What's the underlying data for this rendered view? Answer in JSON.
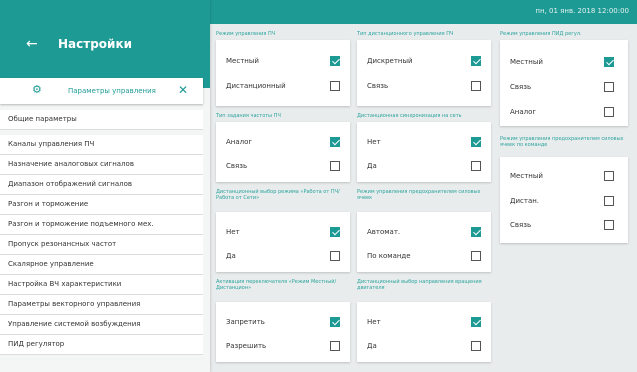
{
  "datetime": "пн, 01 янв. 2018 12:00:00",
  "sidebar": {
    "title": "Настройки",
    "back_icon": "arrow-left-icon",
    "group": {
      "label": "Параметры управления",
      "icon": "gear-icon",
      "close_icon": "close-icon"
    },
    "items": [
      "Общие параметры",
      "Каналы управления ПЧ",
      "Назначение аналоговых сигналов",
      "Диапазон отображений сигналов",
      "Разгон и торможение",
      "Разгон и торможение подъемного мех.",
      "Пропуск резонансных частот",
      "Скалярное управление",
      "Настройка ВЧ характеристики",
      "Параметры векторного управления",
      "Управление системой возбуждения",
      "ПИД регулятор"
    ]
  },
  "colors": {
    "accent": "#1e9a95",
    "background": "#e9ecec"
  },
  "panels": {
    "control_mode": {
      "caption": "Режим управления ПЧ",
      "options": [
        {
          "label": "Местный",
          "checked": true
        },
        {
          "label": "Дистанционный",
          "checked": false
        }
      ]
    },
    "remote_type": {
      "caption": "Тип дистанционного управления ПЧ",
      "options": [
        {
          "label": "Дискретный",
          "checked": true
        },
        {
          "label": "Связь",
          "checked": false
        }
      ]
    },
    "pid_mode": {
      "caption": "Режим управления ПИД регул.",
      "options": [
        {
          "label": "Местный",
          "checked": true
        },
        {
          "label": "Связь",
          "checked": false
        },
        {
          "label": "Аналог",
          "checked": false
        }
      ]
    },
    "freq_task": {
      "caption": "Тип задания частоты ПЧ",
      "options": [
        {
          "label": "Аналог",
          "checked": true
        },
        {
          "label": "Связь",
          "checked": false
        }
      ]
    },
    "remote_sync": {
      "caption": "Дистанционная синхронизация на сеть",
      "options": [
        {
          "label": "Нет",
          "checked": true
        },
        {
          "label": "Да",
          "checked": false
        }
      ]
    },
    "fuse_mode": {
      "caption": "Режим управления предохранителем силовых ячеек по команде",
      "options": [
        {
          "label": "Местный",
          "checked": false
        },
        {
          "label": "Дистан.",
          "checked": false
        },
        {
          "label": "Связь",
          "checked": false
        }
      ]
    },
    "remote_select": {
      "caption": "Дистанционный выбор режима «Работа от ПЧ/ Работа от Сети»",
      "options": [
        {
          "label": "Нет",
          "checked": true
        },
        {
          "label": "Да",
          "checked": false
        }
      ]
    },
    "power_cells": {
      "caption": "Режим управления предохранителем силовых ячеек",
      "options": [
        {
          "label": "Автомат.",
          "checked": true
        },
        {
          "label": "По команде",
          "checked": false
        }
      ]
    },
    "switch_activation": {
      "caption": "Активация переключателя «Режим Местный/Дистанцион»",
      "options": [
        {
          "label": "Запретить",
          "checked": true
        },
        {
          "label": "Разрешить",
          "checked": false
        }
      ]
    },
    "rotation_select": {
      "caption": "Дистанционный выбор направления вращения двигателя",
      "options": [
        {
          "label": "Нет",
          "checked": true
        },
        {
          "label": "Да",
          "checked": false
        }
      ]
    }
  }
}
